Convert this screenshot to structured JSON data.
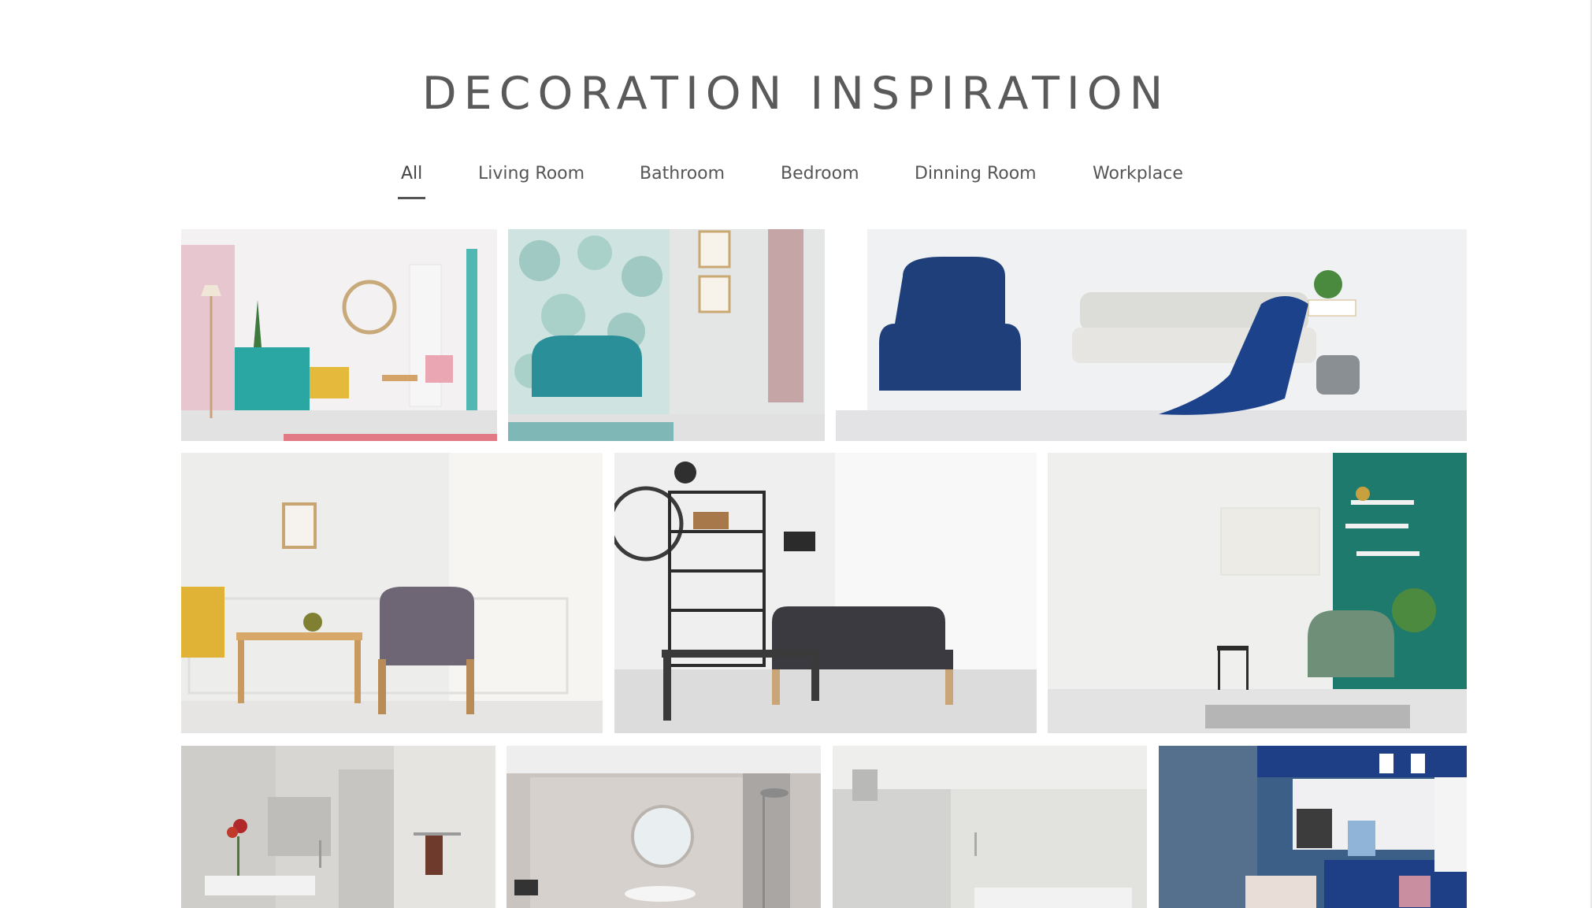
{
  "page": {
    "title": "DECORATION INSPIRATION"
  },
  "filters": {
    "active": "All",
    "tabs": [
      {
        "label": "All"
      },
      {
        "label": "Living Room"
      },
      {
        "label": "Bathroom"
      },
      {
        "label": "Bedroom"
      },
      {
        "label": "Dinning Room"
      },
      {
        "label": "Workplace"
      }
    ]
  },
  "gallery": {
    "photos": [
      {
        "subject": "pastel living room with teal dresser and yellow armchair",
        "accent": "#2aa7a3"
      },
      {
        "subject": "tropical wallpaper with teal loveseat",
        "accent": "#2b8f9a"
      },
      {
        "subject": "navy wingback armchair beside light sofa and hanging swing",
        "accent": "#1f3f7a"
      },
      {
        "subject": "white paneled wall with wooden armchairs and side table",
        "accent": "#6f6675"
      },
      {
        "subject": "black sofa with metal shelving and wall clock",
        "accent": "#3a3a40"
      },
      {
        "subject": "green accent wall with armchair and floating shelves",
        "accent": "#1f7a6e"
      },
      {
        "subject": "grey bathroom with towel rail and red flowers",
        "accent": "#8a2a2a"
      },
      {
        "subject": "bathroom with round mirror and rain shower",
        "accent": "#9a928a"
      },
      {
        "subject": "minimal concrete bathroom",
        "accent": "#c9c9c7"
      },
      {
        "subject": "blue mosaic bathroom with mirror",
        "accent": "#1e3e86"
      }
    ]
  }
}
